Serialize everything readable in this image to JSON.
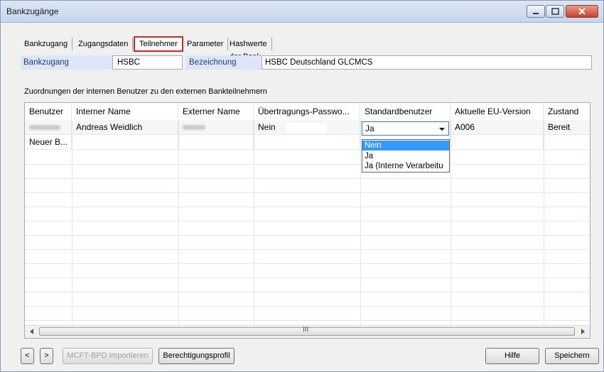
{
  "window": {
    "title": "Bankzugänge"
  },
  "tabs": [
    {
      "label": "Bankzugang"
    },
    {
      "label": "Zugangsdaten"
    },
    {
      "label": "Teilnehmer"
    },
    {
      "label": "Parameter"
    },
    {
      "label": "Hashwerte der Bank"
    }
  ],
  "active_tab": "Teilnehmer",
  "fields": {
    "bankzugang_label": "Bankzugang",
    "bankzugang_value": "HSBC",
    "bezeichnung_label": "Bezeichnung",
    "bezeichnung_value": "HSBC Deutschland GLCMCS"
  },
  "section_caption": "Zuordnungen der internen Benutzer zu den externen Bankteilnehmern",
  "table": {
    "columns": [
      "Benutzer",
      "Interner Name",
      "Externer Name",
      "Übertragungs-Passwo...",
      "Standardbenutzer",
      "Aktuelle EU-Version",
      "Zustand"
    ],
    "rows": [
      {
        "benutzer": "",
        "interner_name": "Andreas Weidlich",
        "externer_name": "",
        "passwort": "Nein",
        "standardbenutzer": "Ja",
        "eu_version": "A006",
        "zustand": "Bereit"
      },
      {
        "benutzer": "Neuer B...",
        "interner_name": "",
        "externer_name": "",
        "passwort": "",
        "standardbenutzer": "",
        "eu_version": "",
        "zustand": ""
      }
    ]
  },
  "dropdown_options": [
    "Nein",
    "Ja",
    "Ja   (Interne Verarbeitu"
  ],
  "dropdown_highlighted": "Nein",
  "scrollbar_grip": "III",
  "buttons": {
    "prev": "<",
    "next": ">",
    "import": "MCFT-BPD importieren",
    "profile": "Berechtigungsprofil",
    "help": "Hilfe",
    "save": "Speichern"
  },
  "colors": {
    "accent_red": "#c42a2a",
    "selection": "#3399ff",
    "label_blue": "#1f3c88"
  }
}
